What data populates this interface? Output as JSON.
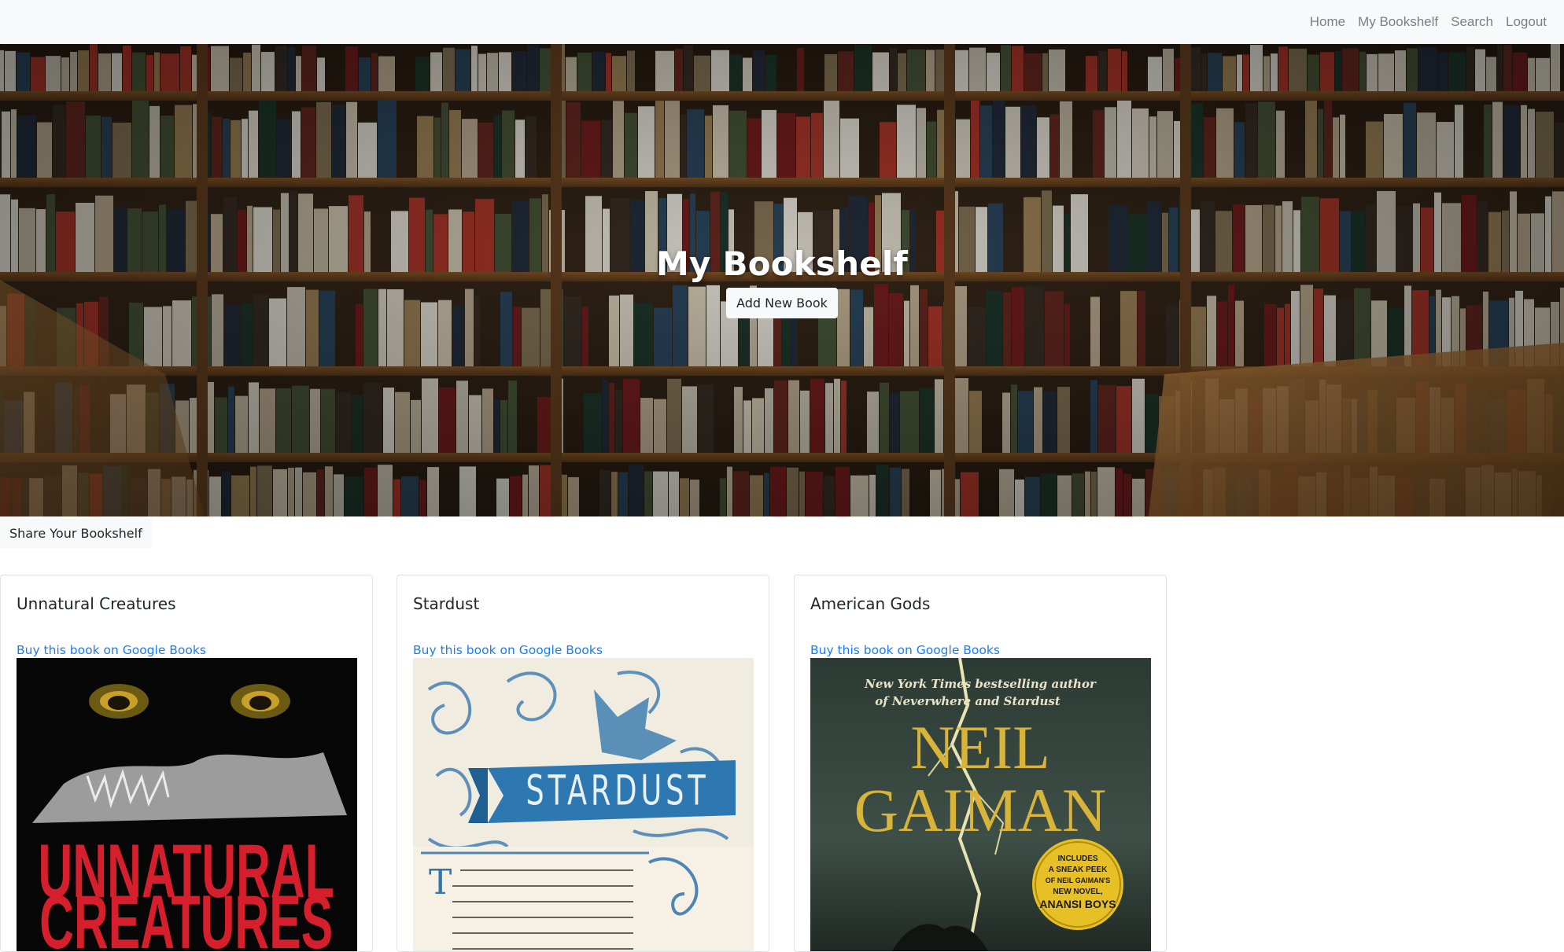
{
  "nav": {
    "items": [
      {
        "label": "Home"
      },
      {
        "label": "My Bookshelf"
      },
      {
        "label": "Search"
      },
      {
        "label": "Logout"
      }
    ]
  },
  "hero": {
    "title": "My Bookshelf",
    "add_button_label": "Add New Book"
  },
  "share": {
    "label": "Share Your Bookshelf"
  },
  "books": [
    {
      "title": "Unnatural Creatures",
      "link_text": "Buy this book on Google Books",
      "cover_text_lines": [
        "UNNATURAL",
        "CREATURES"
      ]
    },
    {
      "title": "Stardust",
      "link_text": "Buy this book on Google Books",
      "cover_text_lines": [
        "STARDUST"
      ]
    },
    {
      "title": "American Gods",
      "link_text": "Buy this book on Google Books",
      "cover_text_lines": [
        "New York Times bestselling author",
        "of Neverwhere and Stardust",
        "NEIL",
        "GAIMAN",
        "INCLUDES",
        "A SNEAK PEEK",
        "OF NEIL GAIMAN'S",
        "NEW NOVEL,",
        "ANANSI BOYS"
      ]
    }
  ],
  "colors": {
    "navbar_bg": "#f8f9fa",
    "nav_link": "#7a7f85",
    "link_blue": "#1e7bf0",
    "card_border": "#dfe2e5"
  }
}
